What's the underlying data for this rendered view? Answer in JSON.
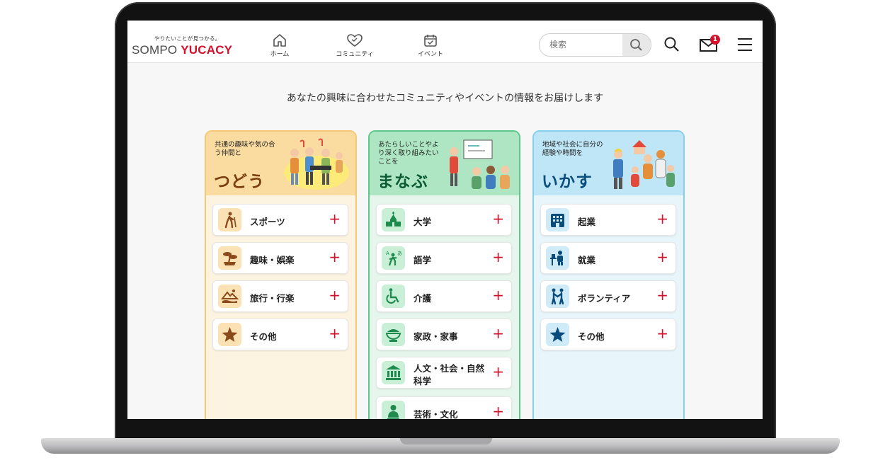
{
  "header": {
    "logo_tagline": "やりたいことが見つかる。",
    "logo_part1": "SOMPO ",
    "logo_part2": "YUCACY",
    "nav": [
      {
        "label": "ホーム",
        "icon": "home-icon"
      },
      {
        "label": "コミュニティ",
        "icon": "community-heart-icon"
      },
      {
        "label": "イベント",
        "icon": "calendar-icon"
      }
    ],
    "search_placeholder": "検索",
    "notification_count": "1"
  },
  "main": {
    "tagline": "あなたの興味に合わせたコミュニティやイベントの情報をお届けします",
    "cards": [
      {
        "desc": "共通の趣味や気の合う仲間と",
        "title": "つどう",
        "color": "#f5c875",
        "items": [
          {
            "label": "スポーツ",
            "icon": "hiking-icon"
          },
          {
            "label": "趣味・娯楽",
            "icon": "bonsai-icon"
          },
          {
            "label": "旅行・行楽",
            "icon": "landscape-icon"
          },
          {
            "label": "その他",
            "icon": "star-icon"
          }
        ]
      },
      {
        "desc": "あたらしいことやより深く取り組みたいことを",
        "title": "まなぶ",
        "color": "#5cc98a",
        "items": [
          {
            "label": "大学",
            "icon": "university-icon"
          },
          {
            "label": "語学",
            "icon": "language-icon"
          },
          {
            "label": "介護",
            "icon": "wheelchair-icon"
          },
          {
            "label": "家政・家事",
            "icon": "rice-bowl-icon"
          },
          {
            "label": "人文・社会・自然科学",
            "label_line1": "人文・社会・自然",
            "label_line2": "科学",
            "icon": "museum-icon"
          },
          {
            "label": "芸術・文化",
            "icon": "sculpture-icon"
          }
        ]
      },
      {
        "desc": "地域や社会に自分の経験や時間を",
        "title": "いかす",
        "color": "#86d0ec",
        "items": [
          {
            "label": "起業",
            "icon": "building-icon"
          },
          {
            "label": "就業",
            "icon": "office-worker-icon"
          },
          {
            "label": "ボランティア",
            "icon": "volunteer-icon"
          },
          {
            "label": "その他",
            "icon": "star-icon"
          }
        ]
      }
    ],
    "plus_symbol": "+"
  }
}
